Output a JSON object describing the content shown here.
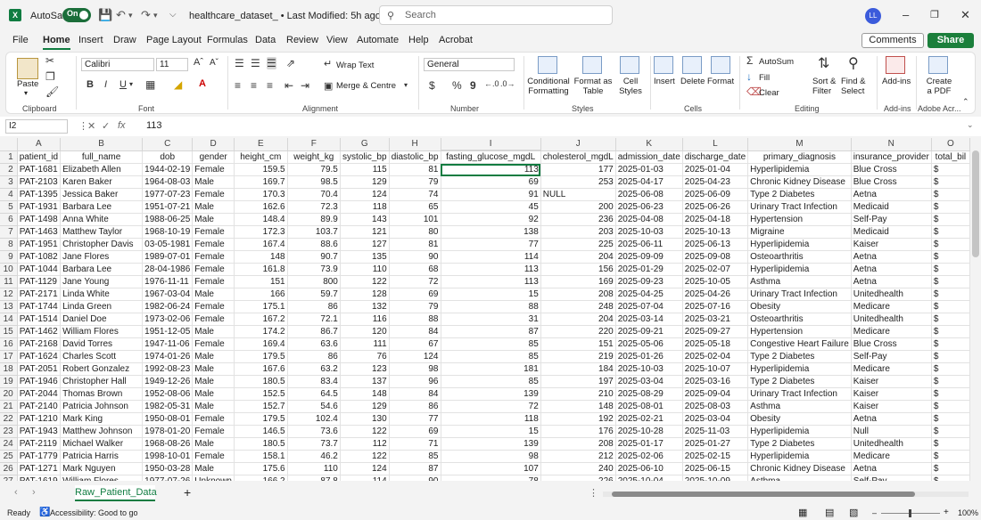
{
  "titlebar": {
    "autosave_label": "AutoSave",
    "autosave_state": "On",
    "doc_title": "healthcare_dataset_  •  Last Modified: 5h ago",
    "search_placeholder": "Search",
    "user_initials": "LL"
  },
  "menu": {
    "items": [
      "File",
      "Home",
      "Insert",
      "Draw",
      "Page Layout",
      "Formulas",
      "Data",
      "Review",
      "View",
      "Automate",
      "Help",
      "Acrobat"
    ],
    "active": "Home",
    "comments": "Comments",
    "share": "Share"
  },
  "ribbon": {
    "clipboard": {
      "paste": "Paste",
      "label": "Clipboard"
    },
    "font": {
      "name": "Calibri",
      "size": "11",
      "label": "Font",
      "bold": "B",
      "italic": "I",
      "underline": "U"
    },
    "alignment": {
      "wrap": "Wrap Text",
      "merge": "Merge & Centre",
      "label": "Alignment"
    },
    "number": {
      "format": "General",
      "label": "Number",
      "currency": "$",
      "percent": "%",
      "comma": "9"
    },
    "styles": {
      "conditional": [
        "Conditional",
        "Formatting"
      ],
      "format_table": [
        "Format as",
        "Table"
      ],
      "cell_styles": [
        "Cell",
        "Styles"
      ],
      "label": "Styles"
    },
    "cells": {
      "insert": "Insert",
      "delete": "Delete",
      "format": "Format",
      "label": "Cells"
    },
    "editing": {
      "autosum": "AutoSum",
      "fill": "Fill",
      "clear": "Clear",
      "sort": [
        "Sort &",
        "Filter"
      ],
      "find": [
        "Find &",
        "Select"
      ],
      "label": "Editing"
    },
    "addins": {
      "btn": "Add-ins",
      "label": "Add-ins"
    },
    "adobe": {
      "btn": [
        "Create",
        "a PDF"
      ],
      "label": "Adobe Acr..."
    }
  },
  "formula_bar": {
    "cell_ref": "I2",
    "fx": "fx",
    "value": "113"
  },
  "sheet": {
    "columns": [
      "A",
      "B",
      "C",
      "D",
      "E",
      "F",
      "G",
      "H",
      "I",
      "J",
      "K",
      "L",
      "M",
      "N",
      "O"
    ],
    "selected_column": "I",
    "selected_row": "2",
    "rows": [
      [
        "1",
        "patient_id",
        "full_name",
        "dob",
        "gender",
        "height_cm",
        "weight_kg",
        "systolic_bp",
        "diastolic_bp",
        "fasting_glucose_mgdL",
        "cholesterol_mgdL",
        "admission_date",
        "discharge_date",
        "primary_diagnosis",
        "insurance_provider",
        "total_bil"
      ],
      [
        "2",
        "PAT-1681",
        "Elizabeth Allen",
        "1944-02-19",
        "Female",
        "159.5",
        "79.5",
        "115",
        "81",
        "113",
        "177",
        "2025-01-03",
        "2025-01-04",
        "Hyperlipidemia",
        "Blue Cross",
        "$"
      ],
      [
        "3",
        "PAT-2103",
        "Karen Baker",
        "1964-08-03",
        "Male",
        "169.7",
        "98.5",
        "129",
        "79",
        "69",
        "253",
        "2025-04-17",
        "2025-04-23",
        "Chronic Kidney Disease",
        "Blue Cross",
        "$"
      ],
      [
        "4",
        "PAT-1395",
        "Jessica Baker",
        "1977-07-23",
        "Female",
        "170.3",
        "70.4",
        "124",
        "74",
        "91",
        "NULL",
        "2025-06-08",
        "2025-06-09",
        "Type 2 Diabetes",
        "Aetna",
        "$"
      ],
      [
        "5",
        "PAT-1931",
        "Barbara Lee",
        "1951-07-21",
        "Male",
        "162.6",
        "72.3",
        "118",
        "65",
        "45",
        "200",
        "2025-06-23",
        "2025-06-26",
        "Urinary Tract Infection",
        "Medicaid",
        "$"
      ],
      [
        "6",
        "PAT-1498",
        "Anna White",
        "1988-06-25",
        "Male",
        "148.4",
        "89.9",
        "143",
        "101",
        "92",
        "236",
        "2025-04-08",
        "2025-04-18",
        "Hypertension",
        "Self-Pay",
        "$"
      ],
      [
        "7",
        "PAT-1463",
        "Matthew Taylor",
        "1968-10-19",
        "Female",
        "172.3",
        "103.7",
        "121",
        "80",
        "138",
        "203",
        "2025-10-03",
        "2025-10-13",
        "Migraine",
        "Medicaid",
        "$"
      ],
      [
        "8",
        "PAT-1951",
        "Christopher Davis",
        "03-05-1981",
        "Female",
        "167.4",
        "88.6",
        "127",
        "81",
        "77",
        "225",
        "2025-06-11",
        "2025-06-13",
        "Hyperlipidemia",
        "Kaiser",
        "$"
      ],
      [
        "9",
        "PAT-1082",
        "Jane Flores",
        "1989-07-01",
        "Female",
        "148",
        "90.7",
        "135",
        "90",
        "114",
        "204",
        "2025-09-09",
        "2025-09-08",
        "Osteoarthritis",
        "Aetna",
        "$"
      ],
      [
        "10",
        "PAT-1044",
        "Barbara Lee",
        "28-04-1986",
        "Female",
        "161.8",
        "73.9",
        "110",
        "68",
        "113",
        "156",
        "2025-01-29",
        "2025-02-07",
        "Hyperlipidemia",
        "Aetna",
        "$"
      ],
      [
        "11",
        "PAT-1129",
        "Jane Young",
        "1976-11-11",
        "Female",
        "151",
        "800",
        "122",
        "72",
        "113",
        "169",
        "2025-09-23",
        "2025-10-05",
        "Asthma",
        "Aetna",
        "$"
      ],
      [
        "12",
        "PAT-2171",
        "Linda White",
        "1967-03-04",
        "Male",
        "166",
        "59.7",
        "128",
        "69",
        "15",
        "208",
        "2025-04-25",
        "2025-04-26",
        "Urinary Tract Infection",
        "Unitedhealth",
        "$"
      ],
      [
        "13",
        "PAT-1744",
        "Linda Green",
        "1982-06-24",
        "Female",
        "175.1",
        "86",
        "132",
        "79",
        "88",
        "248",
        "2025-07-04",
        "2025-07-16",
        "Obesity",
        "Medicare",
        "$"
      ],
      [
        "14",
        "PAT-1514",
        "Daniel Doe",
        "1973-02-06",
        "Female",
        "167.2",
        "72.1",
        "116",
        "88",
        "31",
        "204",
        "2025-03-14",
        "2025-03-21",
        "Osteoarthritis",
        "Unitedhealth",
        "$"
      ],
      [
        "15",
        "PAT-1462",
        "William Flores",
        "1951-12-05",
        "Male",
        "174.2",
        "86.7",
        "120",
        "84",
        "87",
        "220",
        "2025-09-21",
        "2025-09-27",
        "Hypertension",
        "Medicare",
        "$"
      ],
      [
        "16",
        "PAT-2168",
        "David Torres",
        "1947-11-06",
        "Female",
        "169.4",
        "63.6",
        "111",
        "67",
        "85",
        "151",
        "2025-05-06",
        "2025-05-18",
        "Congestive Heart Failure",
        "Blue Cross",
        "$"
      ],
      [
        "17",
        "PAT-1624",
        "Charles Scott",
        "1974-01-26",
        "Male",
        "179.5",
        "86",
        "76",
        "124",
        "85",
        "219",
        "2025-01-26",
        "2025-02-04",
        "Type 2 Diabetes",
        "Self-Pay",
        "$"
      ],
      [
        "18",
        "PAT-2051",
        "Robert Gonzalez",
        "1992-08-23",
        "Male",
        "167.6",
        "63.2",
        "123",
        "98",
        "181",
        "184",
        "2025-10-03",
        "2025-10-07",
        "Hyperlipidemia",
        "Medicare",
        "$"
      ],
      [
        "19",
        "PAT-1946",
        "Christopher Hall",
        "1949-12-26",
        "Male",
        "180.5",
        "83.4",
        "137",
        "96",
        "85",
        "197",
        "2025-03-04",
        "2025-03-16",
        "Type 2 Diabetes",
        "Kaiser",
        "$"
      ],
      [
        "20",
        "PAT-2044",
        "Thomas Brown",
        "1952-08-06",
        "Male",
        "152.5",
        "64.5",
        "148",
        "84",
        "139",
        "210",
        "2025-08-29",
        "2025-09-04",
        "Urinary Tract Infection",
        "Kaiser",
        "$"
      ],
      [
        "21",
        "PAT-2140",
        "Patricia Johnson",
        "1982-05-31",
        "Male",
        "152.7",
        "54.6",
        "129",
        "86",
        "72",
        "148",
        "2025-08-01",
        "2025-08-03",
        "Asthma",
        "Kaiser",
        "$"
      ],
      [
        "22",
        "PAT-1210",
        "Mark King",
        "1950-08-01",
        "Female",
        "179.5",
        "102.4",
        "130",
        "77",
        "118",
        "192",
        "2025-02-21",
        "2025-03-04",
        "Obesity",
        "Aetna",
        "$"
      ],
      [
        "23",
        "PAT-1943",
        "Matthew Johnson",
        "1978-01-20",
        "Female",
        "146.5",
        "73.6",
        "122",
        "69",
        "15",
        "176",
        "2025-10-28",
        "2025-11-03",
        "Hyperlipidemia",
        "Null",
        "$"
      ],
      [
        "24",
        "PAT-2119",
        "Michael Walker",
        "1968-08-26",
        "Male",
        "180.5",
        "73.7",
        "112",
        "71",
        "139",
        "208",
        "2025-01-17",
        "2025-01-27",
        "Type 2 Diabetes",
        "Unitedhealth",
        "$"
      ],
      [
        "25",
        "PAT-1779",
        "Patricia Harris",
        "1998-10-01",
        "Female",
        "158.1",
        "46.2",
        "122",
        "85",
        "98",
        "212",
        "2025-02-06",
        "2025-02-15",
        "Hyperlipidemia",
        "Medicare",
        "$"
      ],
      [
        "26",
        "PAT-1271",
        "Mark Nguyen",
        "1950-03-28",
        "Male",
        "175.6",
        "110",
        "124",
        "87",
        "107",
        "240",
        "2025-06-10",
        "2025-06-15",
        "Chronic Kidney Disease",
        "Aetna",
        "$"
      ],
      [
        "27",
        "PAT-1619",
        "William Flores",
        "1977-07-26",
        "Unknown",
        "166.2",
        "87.8",
        "114",
        "90",
        "78",
        "226",
        "2025-10-04",
        "2025-10-09",
        "Asthma",
        "Self-Pay",
        "$"
      ]
    ]
  },
  "sheet_tab": "Raw_Patient_Data",
  "status": {
    "ready": "Ready",
    "accessibility": "Accessibility: Good to go",
    "zoom": "100%"
  }
}
